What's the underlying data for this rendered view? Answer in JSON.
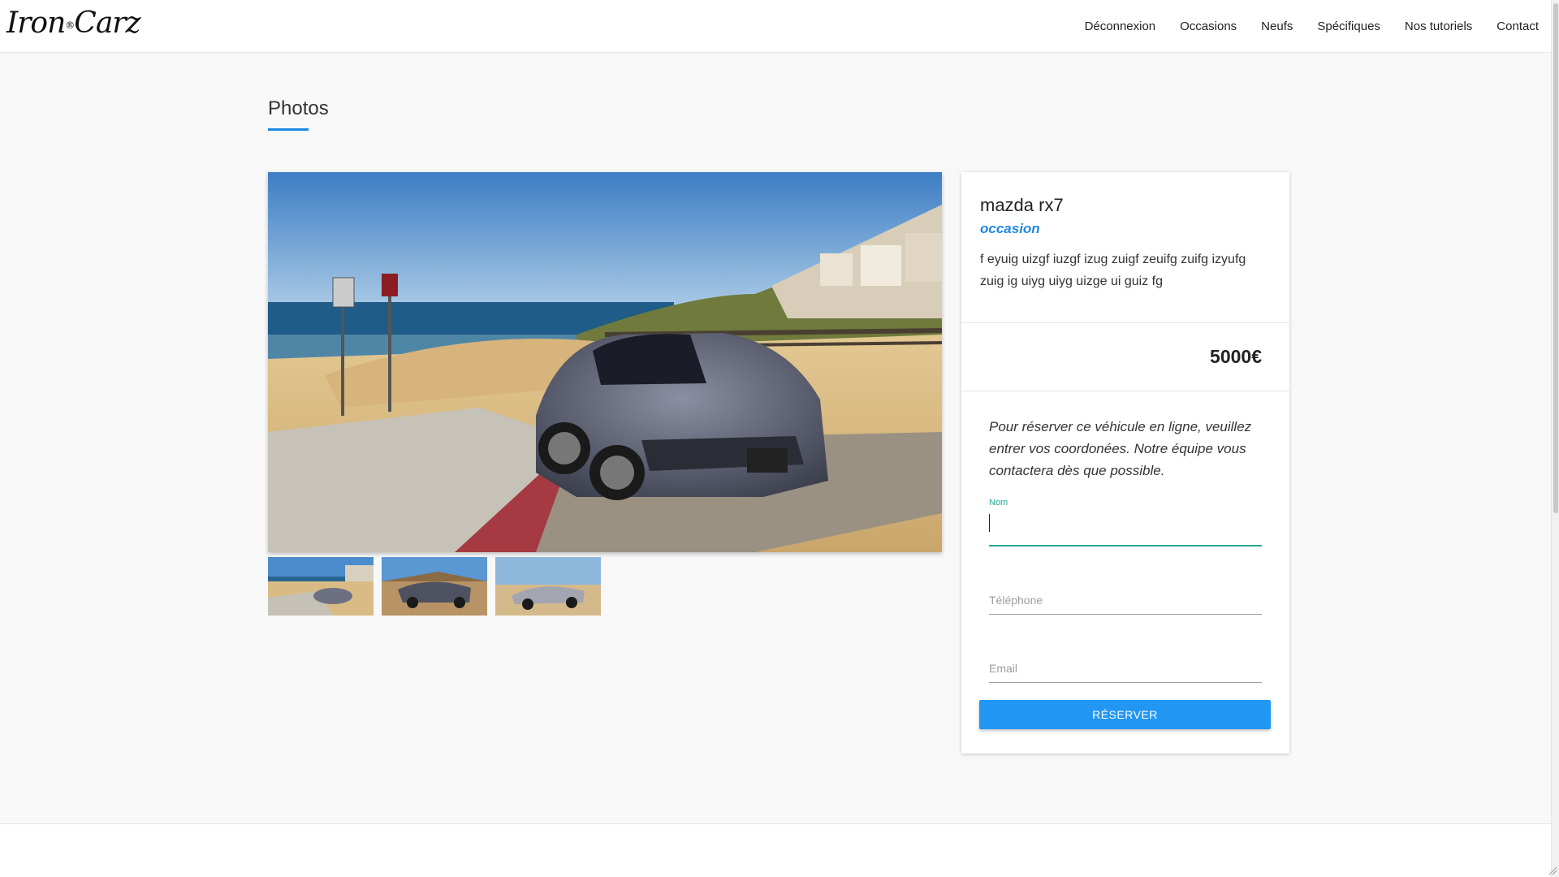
{
  "brand": {
    "logo_text": "Iron",
    "logo_text2": "Carz",
    "logo_mark": "®"
  },
  "nav": {
    "items": [
      {
        "label": "Déconnexion"
      },
      {
        "label": "Occasions"
      },
      {
        "label": "Neufs"
      },
      {
        "label": "Spécifiques"
      },
      {
        "label": "Nos tutoriels"
      },
      {
        "label": "Contact"
      }
    ]
  },
  "gallery": {
    "title": "Photos",
    "thumbnail_count": 3
  },
  "vehicle": {
    "name": "mazda rx7",
    "condition": "occasion",
    "description": "f eyuig uizgf iuzgf izug zuigf zeuifg zuifg izyufg zuig ig uiyg uiyg uizge ui guiz fg",
    "price": "5000€"
  },
  "reservation": {
    "note": "Pour réserver ce véhicule en ligne, veuillez entrer vos coordonées. Notre équipe vous contactera dès que possible.",
    "fields": {
      "name_label": "Nom",
      "name_value": "",
      "phone_label": "Téléphone",
      "email_label": "Email"
    },
    "button_label": "Réserver"
  },
  "colors": {
    "accent": "#1e88e5",
    "button": "#2196f3",
    "focus": "#26a69a"
  }
}
